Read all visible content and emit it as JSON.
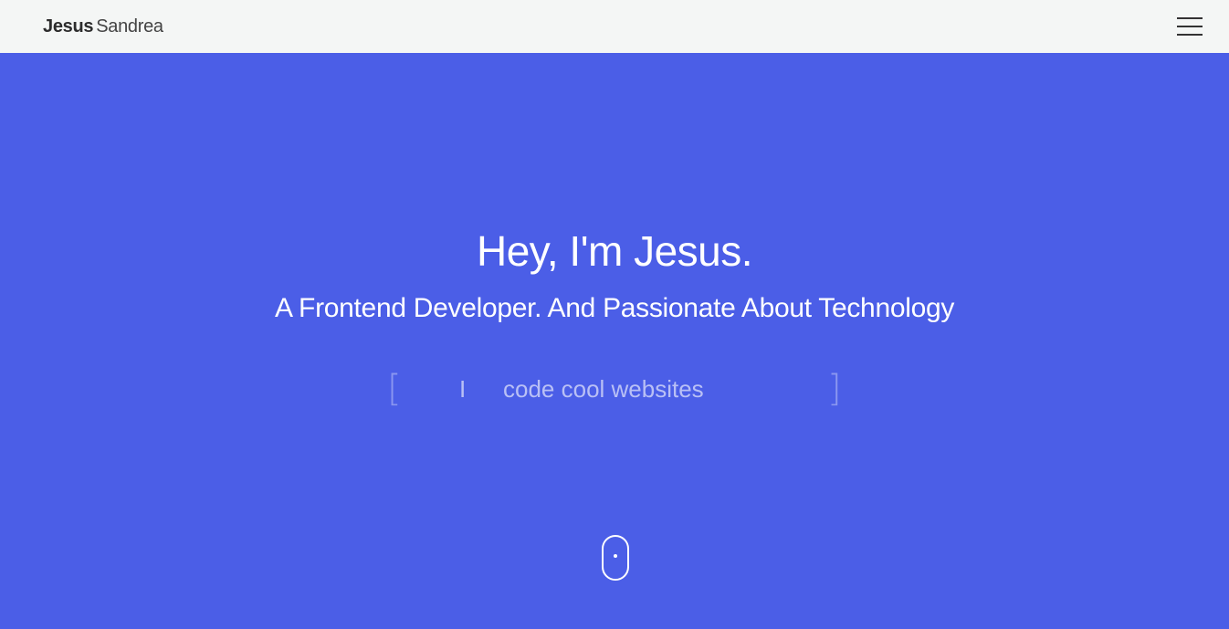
{
  "navbar": {
    "brand_first": "Jesus",
    "brand_last": "Sandrea",
    "menu_icon": "hamburger-menu-icon",
    "background": "#f4f6f5"
  },
  "hero": {
    "background": "#4b5ee7",
    "title": "Hey, I'm Jesus.",
    "subtitle": "A Frontend Developer. And Passionate About Technology",
    "typer": {
      "bracket_left": "[",
      "prefix": "I",
      "text": "code cool websites",
      "bracket_right": "]"
    },
    "scroll_icon": "scroll-mouse-icon"
  }
}
